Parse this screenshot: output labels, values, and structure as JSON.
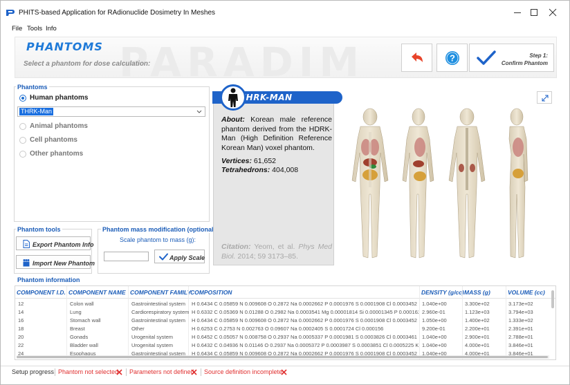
{
  "window": {
    "title": "PHITS-based Application for RAdionuclide Dosimetry In Meshes",
    "menu": [
      "File",
      "Tools",
      "Info"
    ]
  },
  "header": {
    "title": "PHANTOMS",
    "subtitle": "Select a phantom for dose calculation:",
    "watermark": "PARADIM",
    "step_label": "Step 1:",
    "step_action": "Confirm Phantom",
    "icons": {
      "back": "undo-arrow-icon",
      "help": "question-mark-icon",
      "confirm": "check-mark-icon"
    }
  },
  "phantoms": {
    "group_label": "Phantoms",
    "options": [
      {
        "label": "Human phantoms",
        "selected": true
      },
      {
        "label": "Animal phantoms",
        "selected": false
      },
      {
        "label": "Cell phantoms",
        "selected": false
      },
      {
        "label": "Other phantoms",
        "selected": false
      }
    ],
    "selected_phantom": "THRK-Man"
  },
  "phantom_tools": {
    "group_label": "Phantom tools",
    "export_label": "Export Phantom Info",
    "import_label": "Import New Phantom"
  },
  "mass_mod": {
    "group_label": "Phantom mass modification (optional)",
    "scale_label": "Scale phantom to mass (g):",
    "mass_value": "",
    "apply_label": "Apply Scale"
  },
  "phantom_card": {
    "name": "THRK-MAN",
    "about_label": "About:",
    "about_text": "Korean male reference phantom derived from the HDRK-Man (High Definition Reference Korean Man) voxel phantom.",
    "vertices_label": "Vertices:",
    "vertices_value": "61,652",
    "tetra_label": "Tetrahedrons:",
    "tetra_value": "404,008",
    "citation_label": "Citation:",
    "citation_authors": "Yeom, et al.",
    "citation_journal": "Phys Med Biol.",
    "citation_rest": "2014; 59 3173–85."
  },
  "phantom_info": {
    "group_label": "Phantom information",
    "columns": [
      "COMPONENT I.D.",
      "COMPONENT NAME",
      "COMPONENT FAMILY",
      "COMPOSITION",
      "DENSITY (g/cc)",
      "MASS (g)",
      "VOLUME (cc)"
    ],
    "rows": [
      [
        "12",
        "Colon wall",
        "Gastrointestinal system",
        "H 0.6434 C 0.05859 N 0.009608 O 0.2872 Na 0.0002662 P 0.0001976 S 0.0001908 Cl 0.0003452 K 0.0001",
        "1.040e+00",
        "3.300e+02",
        "3.173e+02"
      ],
      [
        "14",
        "Lung",
        "Cardiorespiratory system",
        "H 0.6332 C 0.05369 N 0.01288 O 0.2982 Na 0.0003541 Mg 0.00001814 Si 0.00001345 P 0.0001627 S 0.00",
        "2.960e-01",
        "1.123e+03",
        "3.794e+03"
      ],
      [
        "16",
        "Stomach wall",
        "Gastrointestinal system",
        "H 0.6434 C 0.05859 N 0.009608 O 0.2872 Na 0.0002662 P 0.0001976 S 0.0001908 Cl 0.0003452 K 0.0001",
        "1.050e+00",
        "1.400e+02",
        "1.333e+02"
      ],
      [
        "18",
        "Breast",
        "Other",
        "H 0.6253 C 0.2753 N 0.002763 O 0.09607 Na 0.0002405 S 0.0001724 Cl 0.000156",
        "9.200e-01",
        "2.200e+01",
        "2.391e+01"
      ],
      [
        "20",
        "Gonads",
        "Urogenital system",
        "H 0.6452 C 0.05057 N 0.008758 O 0.2937 Na 0.0005337 P 0.0001981 S 0.0003826 Cl 0.0003461 K 0.0003",
        "1.040e+00",
        "2.900e+01",
        "2.788e+01"
      ],
      [
        "22",
        "Bladder wall",
        "Urogenital system",
        "H 0.6432 C 0.04936 N 0.01146 O 0.2937 Na 0.0005372 P 0.0003987 S 0.0003851 Cl 0.0005225 K 0.00047",
        "1.040e+00",
        "4.000e+01",
        "3.846e+01"
      ],
      [
        "24",
        "Esophagus",
        "Gastrointestinal system",
        "H 0.6434 C 0.05859 N 0.009608 O 0.2872 Na 0.0002662 P 0.0001976 S 0.0001908 Cl 0.0003452 K 0.0001",
        "1.040e+00",
        "4.000e+01",
        "3.846e+01"
      ]
    ]
  },
  "status_bar": {
    "label": "Setup progress",
    "items": [
      "Phantom not selected",
      "Parameters not defined",
      "Source definition incomplete"
    ]
  },
  "colors": {
    "accent": "#1e63c9",
    "label_blue": "#1c5db8",
    "error_red": "#e03030",
    "back_arrow": "#e8442a"
  }
}
